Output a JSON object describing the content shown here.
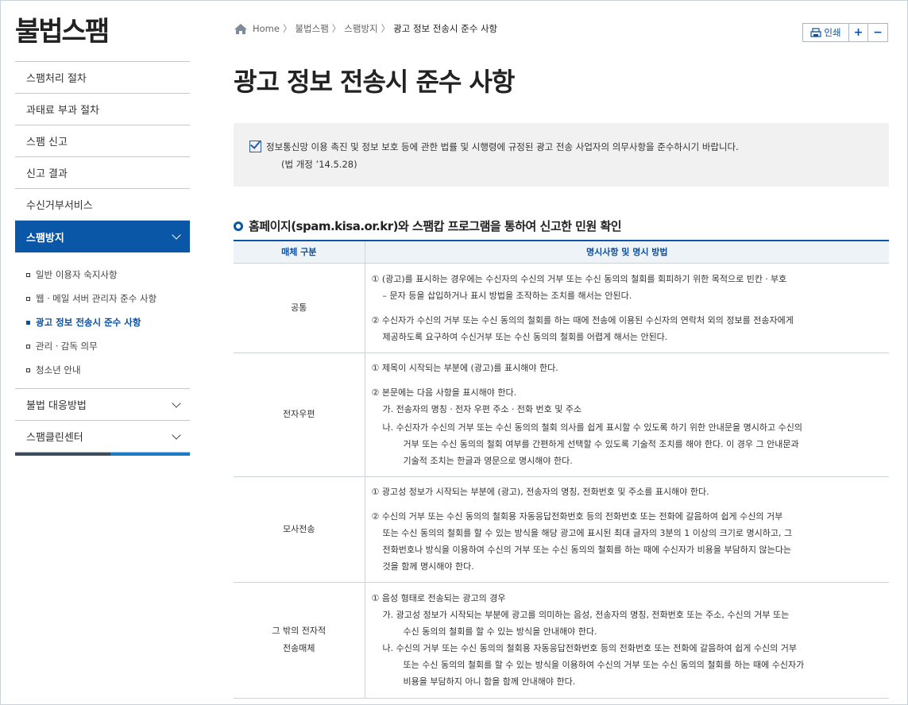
{
  "site_title": "불법스팸",
  "sidebar": {
    "items": [
      {
        "label": "스팸처리 절차"
      },
      {
        "label": "과태료 부과 절차"
      },
      {
        "label": "스팸 신고"
      },
      {
        "label": "신고 결과"
      },
      {
        "label": "수신거부서비스"
      }
    ],
    "active": {
      "label": "스팸방지"
    },
    "sub_items": [
      {
        "label": "일반 이용자 숙지사항"
      },
      {
        "label": "웹ㆍ메일 서버 관리자 준수 사항"
      },
      {
        "label": "광고 정보 전송시 준수 사항"
      },
      {
        "label": "관리ㆍ감독 의무"
      },
      {
        "label": "청소년 안내"
      }
    ],
    "bottom_items": [
      {
        "label": "불법 대응방법"
      },
      {
        "label": "스팸클린센터"
      }
    ]
  },
  "breadcrumb": {
    "home": "Home",
    "sep": "〉",
    "level1": "불법스팸",
    "level2": "스팸방지",
    "current": "광고 정보 전송시 준수 사항"
  },
  "toolbar": {
    "print": "인쇄",
    "plus": "+",
    "minus": "−"
  },
  "page_title": "광고 정보 전송시 준수 사항",
  "notice": {
    "text": "정보통신망 이용 촉진 및 정보 보호 등에 관한 법률 및 시행령에 규정된 광고 전송 사업자의 의무사항을 준수하시기 바랍니다.",
    "sub": "(법 개정 ’14.5.28)"
  },
  "section_title": "홈페이지(spam.kisa.or.kr)와 스팸캅 프로그램을 통하여 신고한 민원 확인",
  "table": {
    "headers": [
      "매체 구분",
      "명시사항 및 명시 방법"
    ],
    "rows": [
      {
        "category": [
          "공통"
        ],
        "paragraphs": [
          [
            "① (광고)를 표시하는 경우에는 수신자의 수신의 거부 또는 수신 동의의 철회를 회피하기 위한 목적으로 빈칸ㆍ부호",
            "  – 문자 등을 삽입하거나 표시 방법을 조작하는 조치를 해서는 안된다."
          ],
          [
            "② 수신자가 수신의 거부 또는 수신 동의의 철회를 하는 때에 전송에 이용된 수신자의 연락처 외의 정보를 전송자에게",
            "제공하도록 요구하여 수신거부 또는 수신 동의의 철회를 어렵게 해서는 안된다."
          ]
        ]
      },
      {
        "category": [
          "전자우편"
        ],
        "paragraphs": [
          [
            "① 제목이 시작되는 부분에 (광고)를 표시해야 한다."
          ],
          [
            "② 본문에는 다음 사항을 표시해야 한다.",
            "가. 전송자의 명칭ㆍ전자 우편 주소ㆍ전화 번호 및 주소"
          ],
          [
            "나. 수신자가 수신의 거부 또는 수신 동의의 철회 의사를 쉽게 표시할 수 있도록 하기 위한 안내문을 명시하고 수신의",
            "거부 또는 수신 동의의 철회 여부를 간편하게 선택할 수 있도록 기술적 조치를 해야 한다. 이 경우 그 안내문과",
            "기술적 조치는 한글과 영문으로 명시해야 한다."
          ]
        ]
      },
      {
        "category": [
          "모사전송"
        ],
        "paragraphs": [
          [
            "① 광고성 정보가 시작되는 부분에 (광고), 전송자의 명칭, 전화번호 및 주소를 표시해야 한다."
          ],
          [
            "② 수신의 거부 또는 수신 동의의 철회용 자동응답전화번호 등의 전화번호 또는 전화에 갈음하여 쉽게 수신의 거부",
            "또는 수신 동의의 철회를 할 수 있는 방식을 해당 광고에 표시된 최대 글자의 3분의 1 이상의 크기로 명시하고, 그",
            "전화번호나 방식을 이용하여 수신의 거부 또는 수신 동의의 철회를 하는 때에 수신자가 비용을 부담하지 않는다는",
            "것을 함께 명시해야 한다."
          ]
        ]
      },
      {
        "category": [
          "그 밖의 전자적",
          "전송매체"
        ],
        "paragraphs": [
          [
            "① 음성 형태로 전송되는 광고의 경우",
            "가. 광고성 정보가 시작되는 부분에 광고를 의미하는 음성, 전송자의 명칭, 전화번호 또는 주소, 수신의 거부 또는",
            "수신 동의의 철회를 할 수 있는 방식을 안내해야 한다.",
            "나. 수신의 거부 또는 수신 동의의 철회용 자동응답전화번호 등의 전화번호 또는 전화에 갈음하여 쉽게 수신의 거부",
            "또는 수신 동의의 철회를 할 수 있는 방식을 이용하여 수신의 거부 또는 수신 동의의 철회를 하는 때에 수신자가",
            "비용을 부담하지 아니 함을 함께 안내해야 한다."
          ]
        ]
      }
    ]
  },
  "colors": {
    "primary": "#0b57a7",
    "header_bg": "#eef3f8",
    "notice_bg": "#f1f1f1"
  }
}
